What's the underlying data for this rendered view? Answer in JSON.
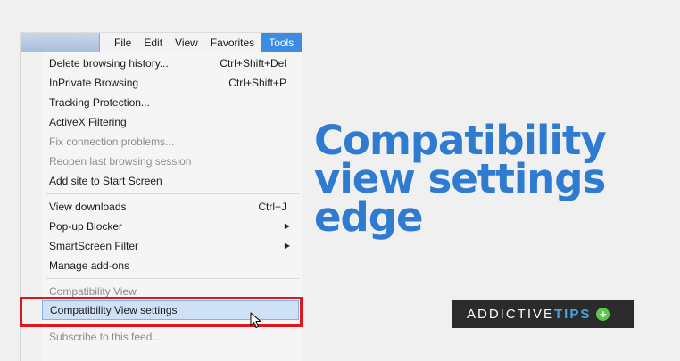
{
  "menubar": {
    "items": [
      "File",
      "Edit",
      "View",
      "Favorites",
      "Tools"
    ],
    "active": "Tools"
  },
  "tools_menu": {
    "items": [
      {
        "label": "Delete browsing history...",
        "shortcut": "Ctrl+Shift+Del"
      },
      {
        "label": "InPrivate Browsing",
        "shortcut": "Ctrl+Shift+P"
      },
      {
        "label": "Tracking Protection..."
      },
      {
        "label": "ActiveX Filtering"
      },
      {
        "label": "Fix connection problems...",
        "disabled": true
      },
      {
        "label": "Reopen last browsing session",
        "disabled": true
      },
      {
        "label": "Add site to Start Screen"
      },
      {
        "label": "View downloads",
        "shortcut": "Ctrl+J"
      },
      {
        "label": "Pop-up Blocker",
        "submenu": true
      },
      {
        "label": "SmartScreen Filter",
        "submenu": true
      },
      {
        "label": "Manage add-ons"
      },
      {
        "label": "Compatibility View",
        "disabled": true
      },
      {
        "label": "Compatibility View settings",
        "highlighted": true
      },
      {
        "label": "Subscribe to this feed...",
        "disabled": true
      }
    ]
  },
  "headline": {
    "line1": "Compatibility",
    "line2": "view settings",
    "line3": "edge",
    "color": "#2e7bd0"
  },
  "brand": {
    "word1": "ADDICTIVE",
    "word2": "TIPS",
    "badge_icon": "plus-circle-icon"
  },
  "colors": {
    "highlight_box": "#e0161c",
    "menu_active": "#3c8ce4",
    "item_highlight": "#cfe1f6"
  }
}
